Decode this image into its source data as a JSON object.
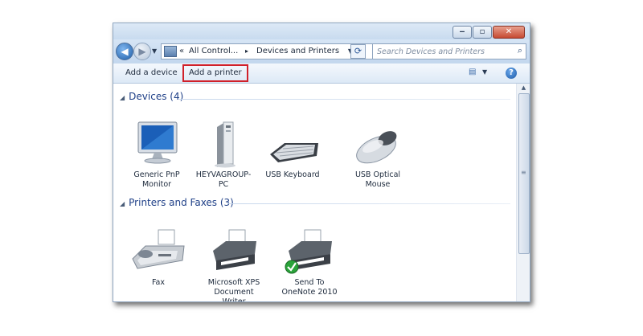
{
  "navigation": {
    "address_segments": [
      "«",
      "All Control...",
      "▸",
      "Devices and Printers"
    ],
    "search_placeholder": "Search Devices and Printers"
  },
  "toolbar": {
    "add_device_label": "Add a device",
    "add_printer_label": "Add a printer",
    "help_glyph": "?"
  },
  "devices": {
    "header": "Devices (4)",
    "items": [
      {
        "label": "Generic PnP Monitor",
        "icon": "monitor-icon"
      },
      {
        "label": "HEYVAGROUP-PC",
        "icon": "computer-tower-icon"
      },
      {
        "label": "USB Keyboard",
        "icon": "keyboard-icon"
      },
      {
        "label": "USB Optical Mouse",
        "icon": "mouse-icon"
      }
    ]
  },
  "printers": {
    "header": "Printers and Faxes (3)",
    "items": [
      {
        "label": "Fax",
        "icon": "fax-icon"
      },
      {
        "label": "Microsoft XPS Document Writer",
        "icon": "printer-icon"
      },
      {
        "label": "Send To OneNote 2010",
        "icon": "printer-default-icon"
      }
    ]
  },
  "colors": {
    "highlight_border": "#d0202a",
    "group_header": "#1e3f87"
  }
}
